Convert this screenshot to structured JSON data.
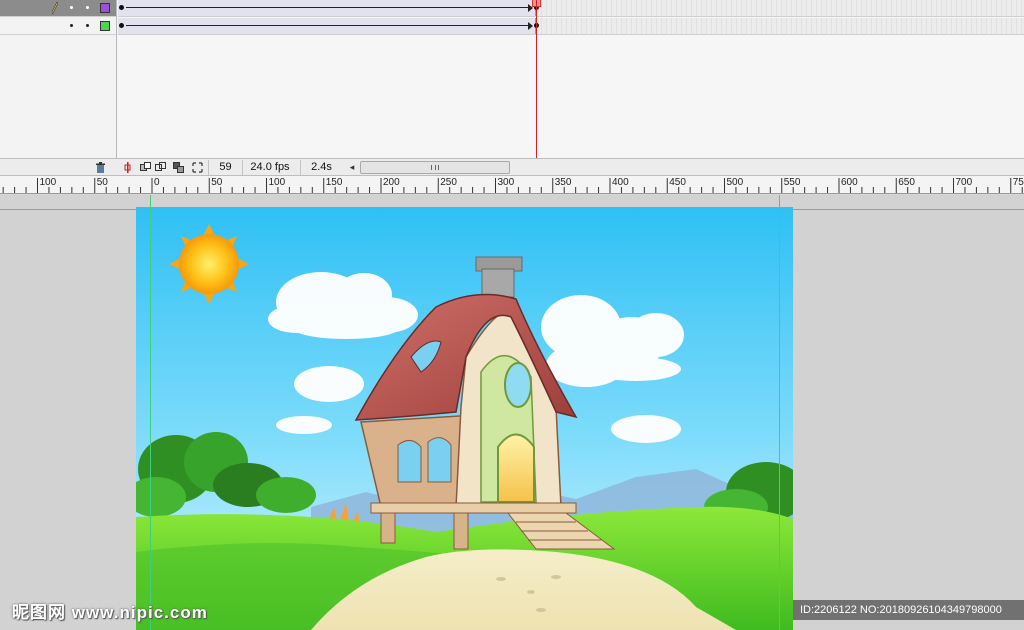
{
  "timeline": {
    "layers": [
      {
        "name_visible": false,
        "selected": true,
        "swatch_color": "#9b4fd1"
      },
      {
        "name_visible": false,
        "selected": false,
        "swatch_color": "#52d152"
      }
    ]
  },
  "status": {
    "current_frame": "59",
    "frame_rate": "24.0 fps",
    "elapsed_time": "2.4s"
  },
  "ruler": {
    "ticks": [
      "100",
      "50",
      "0",
      "50",
      "100",
      "150",
      "200",
      "250",
      "300",
      "350",
      "400",
      "450",
      "500",
      "550",
      "600",
      "650",
      "700",
      "750"
    ]
  },
  "watermark": {
    "left_text": "昵图网 www.nipic.com",
    "right_text": "ID:2206122 NO:20180926104349798000"
  },
  "colors": {
    "sky": "#3ec8f5",
    "grass": "#5fd12e",
    "roof": "#b4504a",
    "guide": "#3fd07a",
    "playhead": "#cc2222"
  }
}
